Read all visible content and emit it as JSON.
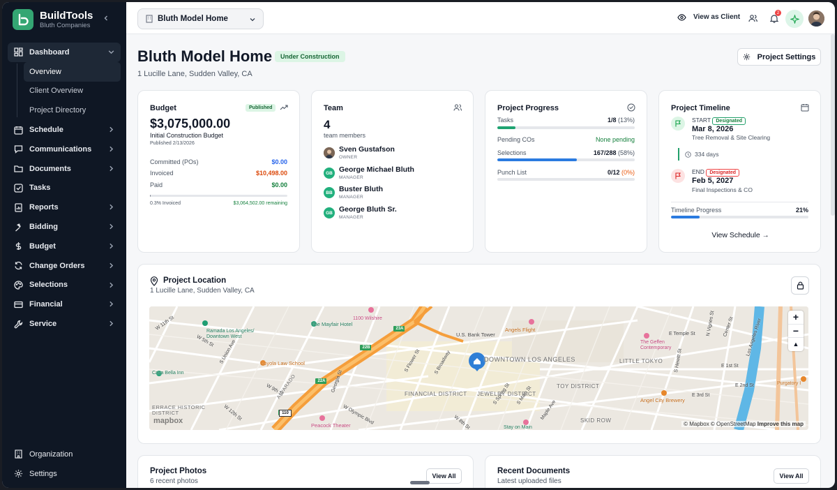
{
  "brand": {
    "name": "BuildTools",
    "company": "Bluth Companies"
  },
  "sidebar": {
    "items": [
      {
        "label": "Dashboard"
      },
      {
        "label": "Schedule"
      },
      {
        "label": "Communications"
      },
      {
        "label": "Documents"
      },
      {
        "label": "Tasks"
      },
      {
        "label": "Reports"
      },
      {
        "label": "Bidding"
      },
      {
        "label": "Budget"
      },
      {
        "label": "Change Orders"
      },
      {
        "label": "Selections"
      },
      {
        "label": "Financial"
      },
      {
        "label": "Service"
      }
    ],
    "dashboard_sub": [
      {
        "label": "Overview"
      },
      {
        "label": "Client Overview"
      },
      {
        "label": "Project Directory"
      }
    ],
    "bottom": [
      {
        "label": "Organization"
      },
      {
        "label": "Settings"
      }
    ]
  },
  "topbar": {
    "project_select": "Bluth Model Home",
    "view_as_client": "View as Client",
    "notification_count": "2"
  },
  "header": {
    "title": "Bluth Model Home",
    "status": "Under Construction",
    "address": "1 Lucille Lane, Sudden Valley, CA",
    "settings_button": "Project Settings"
  },
  "budget": {
    "title": "Budget",
    "badge": "Published",
    "amount": "$3,075,000.00",
    "subtitle": "Initial Construction Budget",
    "published": "Published 2/13/2026",
    "rows": [
      {
        "label": "Committed (POs)",
        "value": "$0.00",
        "color": "#2563eb"
      },
      {
        "label": "Invoiced",
        "value": "$10,498.00",
        "color": "#dc4a0c"
      },
      {
        "label": "Paid",
        "value": "$0.00",
        "color": "#15803d"
      }
    ],
    "invoiced_fraction": 0.003,
    "invoiced_text": "0.3% Invoiced",
    "remaining_text": "$3,064,502.00 remaining"
  },
  "team": {
    "title": "Team",
    "count": "4",
    "count_label": "team members",
    "members": [
      {
        "initials": "",
        "name": "Sven Gustafson",
        "role": "OWNER"
      },
      {
        "initials": "GB",
        "name": "George Michael Bluth",
        "role": "MANAGER"
      },
      {
        "initials": "BB",
        "name": "Buster Bluth",
        "role": "MANAGER"
      },
      {
        "initials": "GB",
        "name": "George Bluth Sr.",
        "role": "MANAGER"
      }
    ]
  },
  "progress": {
    "title": "Project Progress",
    "tasks": {
      "label": "Tasks",
      "value": "1/8",
      "pct": "(13%)",
      "fraction": 0.13
    },
    "pending": {
      "label": "Pending COs",
      "value": "None pending"
    },
    "selections": {
      "label": "Selections",
      "value": "167/288",
      "pct": "(58%)",
      "fraction": 0.58
    },
    "punch": {
      "label": "Punch List",
      "value": "0/12",
      "pct": "(0%)",
      "fraction": 0
    }
  },
  "timeline": {
    "title": "Project Timeline",
    "start": {
      "label": "START",
      "badge": "Designated",
      "date": "Mar 8, 2026",
      "desc": "Tree Removal & Site Clearing"
    },
    "duration": "334 days",
    "end": {
      "label": "END",
      "badge": "Designated",
      "date": "Feb 5, 2027",
      "desc": "Final Inspections & CO"
    },
    "progress_label": "Timeline Progress",
    "progress_pct": "21%",
    "progress_fraction": 0.21,
    "view_schedule": "View Schedule"
  },
  "location": {
    "title": "Project Location",
    "address": "1 Lucille Lane, Sudden Valley, CA",
    "attribution": "© Mapbox © OpenStreetMap",
    "improve": "Improve this map",
    "mapbox": "mapbox",
    "labels": [
      "W 11th St",
      "Ramada Los Angeles/ Downtown West",
      "The Mayfair Hotel",
      "1100 Wilshire",
      "Angels Flight",
      "U.S. Bank Tower",
      "Loyola Law School",
      "Casa Bella Inn",
      "DOWNTOWN LOS ANGELES",
      "LITTLE TOKYO",
      "The Geffen Contemporary",
      "TOY DISTRICT",
      "FINANCIAL DISTRICT",
      "JEWELRY DISTRICT",
      "SKID ROW",
      "Angel City Brewery",
      "Purgatory I",
      "Peacock Theater",
      "Stay on Main",
      "E Temple St",
      "E 1st St",
      "E 3rd St",
      "S Main St",
      "S Spring St",
      "S Flower St",
      "W Olympic Blvd",
      "W 8th St",
      "ALVARADO",
      "ERRACE HISTORIC DISTRICT",
      "Center St",
      "N Vignes St",
      "E 2nd St",
      "W 12th St",
      "S Union Ave",
      "Georgia St",
      "W 9th St",
      "S Broadway",
      "Maple Ave",
      "W 5th St",
      "S Hewitt St",
      "Los Angeles River"
    ],
    "shields": [
      "23A",
      "22B",
      "22A",
      "110"
    ]
  },
  "photos": {
    "title": "Project Photos",
    "subtitle": "6 recent photos",
    "button": "View All"
  },
  "documents": {
    "title": "Recent Documents",
    "subtitle": "Latest uploaded files",
    "button": "View All"
  }
}
